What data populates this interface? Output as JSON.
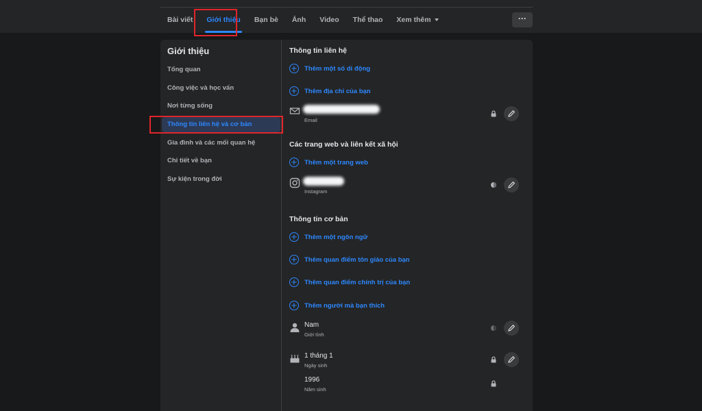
{
  "tabs": [
    {
      "label": "Bài viết",
      "active": false
    },
    {
      "label": "Giới thiệu",
      "active": true
    },
    {
      "label": "Bạn bè",
      "active": false
    },
    {
      "label": "Ảnh",
      "active": false
    },
    {
      "label": "Video",
      "active": false
    },
    {
      "label": "Thể thao",
      "active": false
    },
    {
      "label": "Xem thêm",
      "active": false,
      "dropdown": true
    }
  ],
  "more_button": "···",
  "sidebar": {
    "title": "Giới thiệu",
    "items": [
      {
        "label": "Tổng quan"
      },
      {
        "label": "Công việc và học vấn"
      },
      {
        "label": "Nơi từng sống"
      },
      {
        "label": "Thông tin liên hệ và cơ bản",
        "active": true
      },
      {
        "label": "Gia đình và các mối quan hệ"
      },
      {
        "label": "Chi tiết về bạn"
      },
      {
        "label": "Sự kiện trong đời"
      }
    ]
  },
  "contact": {
    "title": "Thông tin liên hệ",
    "add_phone": "Thêm một số di động",
    "add_address": "Thêm địa chỉ của bạn",
    "email_label": "Email"
  },
  "websites": {
    "title": "Các trang web và liên kết xã hội",
    "add_website": "Thêm một trang web",
    "instagram_label": "Instagram"
  },
  "basic": {
    "title": "Thông tin cơ bản",
    "add_language": "Thêm một ngôn ngữ",
    "add_religion": "Thêm quan điểm tôn giáo của bạn",
    "add_political": "Thêm quan điểm chính trị của bạn",
    "add_interested": "Thêm người mà bạn thích",
    "gender": {
      "value": "Nam",
      "label": "Giới tính"
    },
    "birthday": {
      "value": "1 tháng 1",
      "label": "Ngày sinh"
    },
    "birthyear": {
      "value": "1996",
      "label": "Năm sinh"
    }
  },
  "colors": {
    "background": "#18191a",
    "card": "#242526",
    "accent": "#2d88ff",
    "highlight": "#e0262c"
  }
}
